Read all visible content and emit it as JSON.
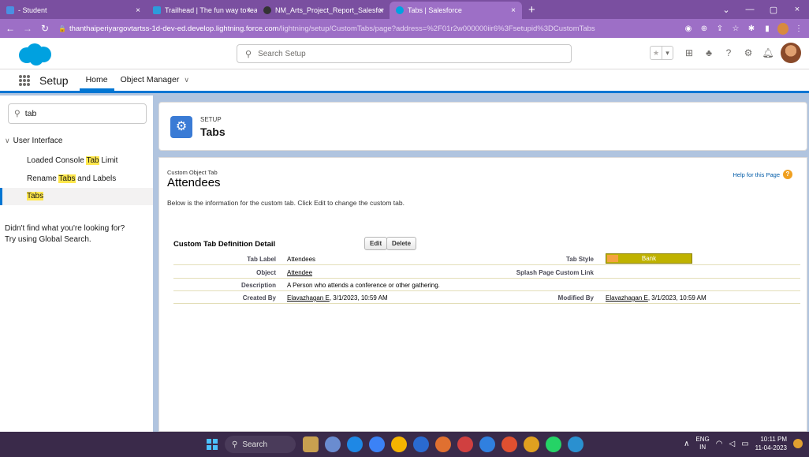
{
  "browser": {
    "tabs": [
      {
        "title": "- Student",
        "close": "×",
        "color": "#4a90e2"
      },
      {
        "title": "Trailhead | The fun way to learn",
        "close": "×",
        "color": "#2d9cdb"
      },
      {
        "title": "NM_Arts_Project_Report_Salesfor",
        "close": "×",
        "color": "#333333"
      },
      {
        "title": "Tabs | Salesforce",
        "close": "×",
        "color": "#00a1e0"
      }
    ],
    "new_tab": "+",
    "window_controls": [
      "⌄",
      "—",
      "▢",
      "×"
    ],
    "url_host": "thanthaiperiyargovtartss-1d-dev-ed.develop.lightning.force.com",
    "url_path": "/lightning/setup/CustomTabs/page?address=%2F01r2w000000iir6%3Fsetupid%3DCustomTabs"
  },
  "header": {
    "search_placeholder": "Search Setup"
  },
  "setup_nav": {
    "title": "Setup",
    "home": "Home",
    "object_manager": "Object Manager"
  },
  "sidebar": {
    "quick_find_value": "tab",
    "section": "User Interface",
    "items": [
      {
        "before": "Loaded Console ",
        "match": "Tab",
        "after": " Limit"
      },
      {
        "before": "Rename ",
        "match": "Tabs",
        "after": " and Labels"
      },
      {
        "before": "",
        "match": "Tabs",
        "after": ""
      }
    ],
    "not_found_line1": "Didn't find what you're looking for?",
    "not_found_line2": "Try using Global Search."
  },
  "page_header": {
    "kicker": "SETUP",
    "title": "Tabs"
  },
  "detail": {
    "kicker": "Custom Object Tab",
    "title": "Attendees",
    "help": "Help for this Page",
    "intro": "Below is the information for the custom tab. Click Edit to change the custom tab.",
    "section_title": "Custom Tab Definition Detail",
    "edit": "Edit",
    "delete": "Delete",
    "rows": {
      "tab_label": {
        "label": "Tab Label",
        "value": "Attendees"
      },
      "tab_style": {
        "label": "Tab Style",
        "value": "Bank"
      },
      "object": {
        "label": "Object",
        "value": "Attendee"
      },
      "splash": {
        "label": "Splash Page Custom Link",
        "value": ""
      },
      "description": {
        "label": "Description",
        "value": "A Person who attends a conference or other gathering."
      },
      "created_by": {
        "label": "Created By",
        "user": "Elavazhagan E",
        "date": ", 3/1/2023, 10:59 AM"
      },
      "modified_by": {
        "label": "Modified By",
        "user": "Elavazhagan E",
        "date": ", 3/1/2023, 10:59 AM"
      }
    }
  },
  "taskbar": {
    "search": "Search",
    "lang_line1": "ENG",
    "lang_line2": "IN",
    "time": "10:11 PM",
    "date": "11-04-2023",
    "app_colors": [
      "#c8a050",
      "#6a8cd0",
      "#1e88e5",
      "#3b82f6",
      "#f5b400",
      "#2a6ad0",
      "#e07030",
      "#d04040",
      "#3080e0",
      "#e05030",
      "#e0a020",
      "#25d366",
      "#2a90d0"
    ]
  }
}
